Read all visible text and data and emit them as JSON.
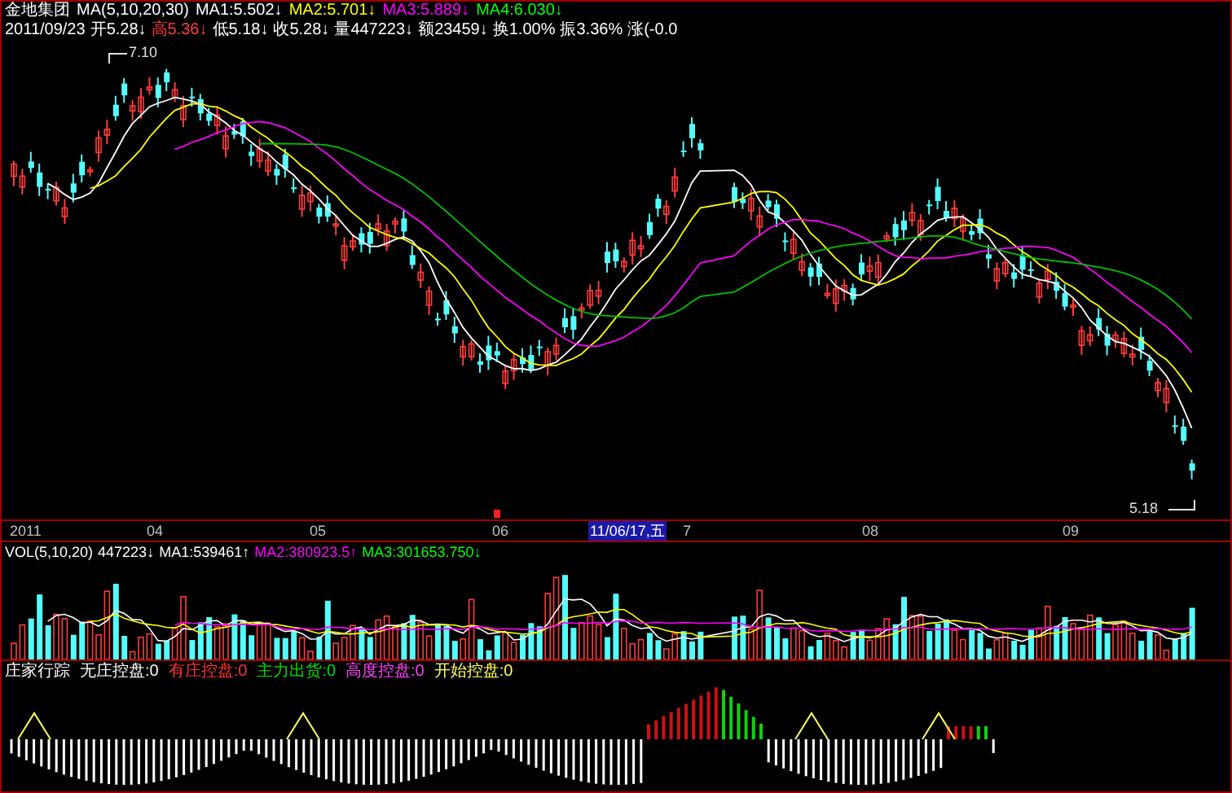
{
  "stock_name": "金地集团",
  "ma_legend": {
    "label": "MA(5,10,20,30)",
    "items": [
      {
        "text": "MA1:5.502",
        "arrow": "↓",
        "color": "#ffffff"
      },
      {
        "text": "MA2:5.701",
        "arrow": "↓",
        "color": "#ffff00"
      },
      {
        "text": "MA3:5.889",
        "arrow": "↓",
        "color": "#ff00ff"
      },
      {
        "text": "MA4:6.030",
        "arrow": "↓",
        "color": "#00ff00"
      }
    ]
  },
  "quote_line": [
    {
      "text": "2011/09/23",
      "color": "#ffffff"
    },
    {
      "text": "开5.28",
      "arrow": "↓",
      "color": "#ffffff"
    },
    {
      "text": "高5.36",
      "arrow": "↓",
      "color": "#ff3c3c"
    },
    {
      "text": "低5.18",
      "arrow": "↓",
      "color": "#ffffff"
    },
    {
      "text": "收5.28",
      "arrow": "↓",
      "color": "#ffffff"
    },
    {
      "text": "量447223",
      "arrow": "↓",
      "color": "#ffffff"
    },
    {
      "text": "额23459",
      "arrow": "↓",
      "color": "#ffffff"
    },
    {
      "text": "换1.00%",
      "color": "#ffffff"
    },
    {
      "text": "振3.36%",
      "color": "#ffffff"
    },
    {
      "text": "涨(-0.0",
      "color": "#ffffff"
    }
  ],
  "price_chart": {
    "high_label": "7.10",
    "low_label": "5.18"
  },
  "date_axis": [
    {
      "text": "2011",
      "selected": false
    },
    {
      "text": "04",
      "selected": false
    },
    {
      "text": "05",
      "selected": false
    },
    {
      "text": "06",
      "selected": false
    },
    {
      "text": "11/06/17,五",
      "selected": true
    },
    {
      "text": "7",
      "selected": false
    },
    {
      "text": "08",
      "selected": false
    },
    {
      "text": "09",
      "selected": false
    }
  ],
  "volume_legend": {
    "label": "VOL(5,10,20)",
    "items": [
      {
        "text": "447223",
        "arrow": "↓",
        "color": "#ffffff"
      },
      {
        "text": "MA1:539461",
        "arrow": "↑",
        "color": "#ffffff"
      },
      {
        "text": "MA2:380923.5",
        "arrow": "↑",
        "color": "#ff00ff"
      },
      {
        "text": "MA3:301653.750",
        "arrow": "↓",
        "color": "#00ff00"
      }
    ]
  },
  "indicator_legend": {
    "label": "庄家行踪",
    "items": [
      {
        "text": "无庄控盘:0",
        "color": "#ffffff"
      },
      {
        "text": "有庄控盘:0",
        "color": "#ff3030"
      },
      {
        "text": "主力出货:0",
        "color": "#00e000"
      },
      {
        "text": "高度控盘:0",
        "color": "#ff40ff"
      },
      {
        "text": "开始控盘:0",
        "color": "#ffff60"
      }
    ]
  }
}
